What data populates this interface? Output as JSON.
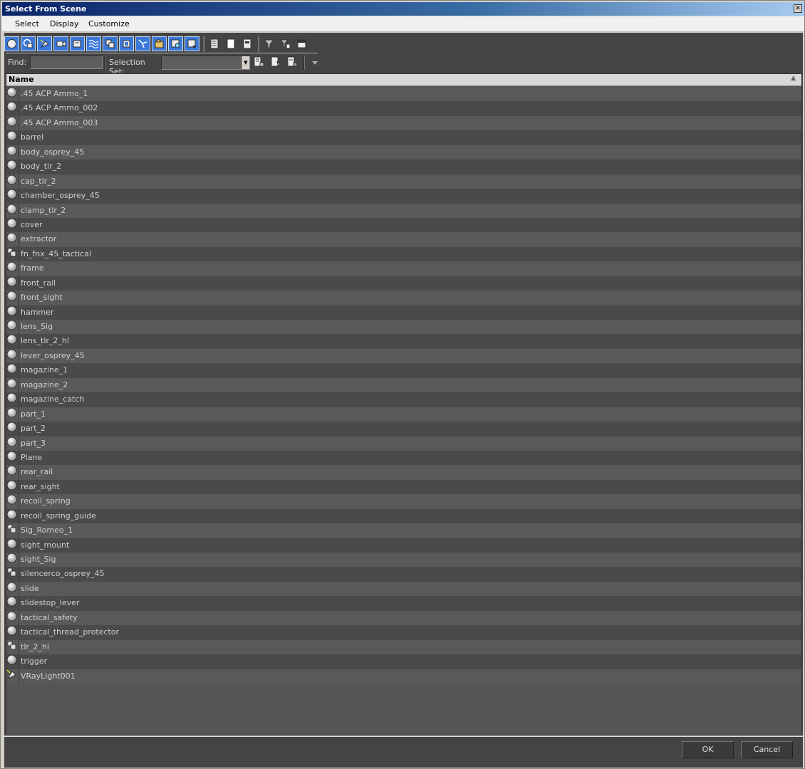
{
  "window": {
    "title": "Select From Scene",
    "close_glyph": "✕"
  },
  "menu": {
    "items": [
      "Select",
      "Display",
      "Customize"
    ]
  },
  "toolbar": {
    "type_filters": [
      "geometry-icon",
      "shapes-icon",
      "lights-icon",
      "cameras-icon",
      "helpers-icon",
      "spacewarps-icon",
      "groups-icon",
      "xrefs-icon",
      "bones-icon",
      "containers-icon",
      "frozen-icon",
      "hidden-icon"
    ],
    "select_buttons": [
      "select-all-icon",
      "select-none-icon",
      "select-invert-icon"
    ],
    "extra_buttons": [
      "filter-icon",
      "filter-options-icon",
      "collapse-icon"
    ]
  },
  "find": {
    "label": "Find:",
    "value": ""
  },
  "selection_set": {
    "label": "Selection Set:",
    "value": ""
  },
  "list": {
    "header": "Name",
    "sort_glyph": "▲",
    "items": [
      {
        "name": ".45 ACP Ammo_1",
        "icon": "geometry"
      },
      {
        "name": ".45 ACP Ammo_002",
        "icon": "geometry"
      },
      {
        "name": ".45 ACP Ammo_003",
        "icon": "geometry"
      },
      {
        "name": "barrel",
        "icon": "geometry"
      },
      {
        "name": "body_osprey_45",
        "icon": "geometry"
      },
      {
        "name": "body_tlr_2",
        "icon": "geometry"
      },
      {
        "name": "cap_tlr_2",
        "icon": "geometry"
      },
      {
        "name": "chamber_osprey_45",
        "icon": "geometry"
      },
      {
        "name": "clamp_tlr_2",
        "icon": "geometry"
      },
      {
        "name": "cover",
        "icon": "geometry"
      },
      {
        "name": "extractor",
        "icon": "geometry"
      },
      {
        "name": "fn_fnx_45_tactical",
        "icon": "group"
      },
      {
        "name": "frame",
        "icon": "geometry"
      },
      {
        "name": "front_rail",
        "icon": "geometry"
      },
      {
        "name": "front_sight",
        "icon": "geometry"
      },
      {
        "name": "hammer",
        "icon": "geometry"
      },
      {
        "name": "lens_Sig",
        "icon": "geometry"
      },
      {
        "name": "lens_tlr_2_hl",
        "icon": "geometry"
      },
      {
        "name": "lever_osprey_45",
        "icon": "geometry"
      },
      {
        "name": "magazine_1",
        "icon": "geometry"
      },
      {
        "name": "magazine_2",
        "icon": "geometry"
      },
      {
        "name": "magazine_catch",
        "icon": "geometry"
      },
      {
        "name": "part_1",
        "icon": "geometry"
      },
      {
        "name": "part_2",
        "icon": "geometry"
      },
      {
        "name": "part_3",
        "icon": "geometry"
      },
      {
        "name": "Plane",
        "icon": "geometry"
      },
      {
        "name": "rear_rail",
        "icon": "geometry"
      },
      {
        "name": "rear_sight",
        "icon": "geometry"
      },
      {
        "name": "recoil_spring",
        "icon": "geometry"
      },
      {
        "name": "recoil_spring_guide",
        "icon": "geometry"
      },
      {
        "name": "Sig_Romeo_1",
        "icon": "group"
      },
      {
        "name": "sight_mount",
        "icon": "geometry"
      },
      {
        "name": "sight_Sig",
        "icon": "geometry"
      },
      {
        "name": "silencerco_osprey_45",
        "icon": "group"
      },
      {
        "name": "slide",
        "icon": "geometry"
      },
      {
        "name": "slidestop_lever",
        "icon": "geometry"
      },
      {
        "name": "tactical_safety",
        "icon": "geometry"
      },
      {
        "name": "tactical_thread_protector",
        "icon": "geometry"
      },
      {
        "name": "tlr_2_hl",
        "icon": "group"
      },
      {
        "name": "trigger",
        "icon": "geometry"
      },
      {
        "name": "VRayLight001",
        "icon": "light"
      }
    ]
  },
  "buttons": {
    "ok": "OK",
    "cancel": "Cancel"
  }
}
